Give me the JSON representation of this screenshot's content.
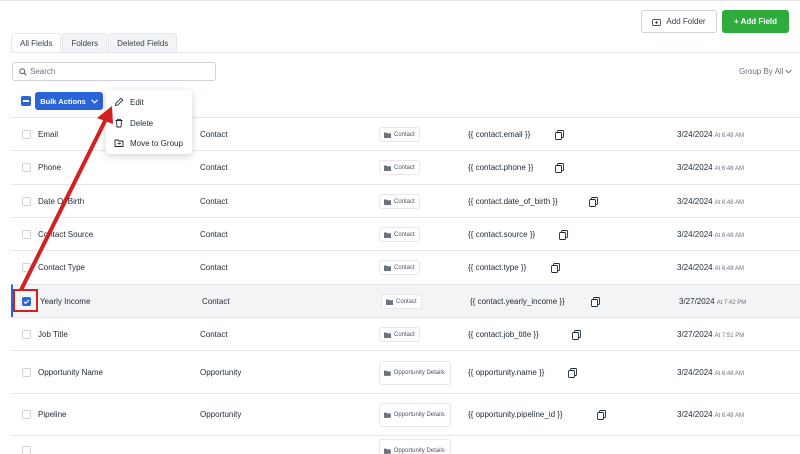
{
  "header": {
    "add_folder_label": "Add Folder",
    "add_field_label": "+ Add Field"
  },
  "tabs": [
    {
      "label": "All Fields",
      "active": true
    },
    {
      "label": "Folders",
      "active": false
    },
    {
      "label": "Deleted Fields",
      "active": false
    }
  ],
  "search": {
    "placeholder": "Search"
  },
  "group_by": {
    "label": "Group By All"
  },
  "bulk_actions": {
    "label": "Bulk Actions",
    "menu": [
      "Edit",
      "Delete",
      "Move to Group"
    ]
  },
  "rows": [
    {
      "name": "Email",
      "object": "Contact",
      "folder": "Contact",
      "key": "{{ contact.email }}",
      "date": "3/24/2024",
      "time": "At 6:48 AM",
      "checked": false
    },
    {
      "name": "Phone",
      "object": "Contact",
      "folder": "Contact",
      "key": "{{ contact.phone }}",
      "date": "3/24/2024",
      "time": "At 6:48 AM",
      "checked": false
    },
    {
      "name": "Date Of Birth",
      "object": "Contact",
      "folder": "Contact",
      "key": "{{ contact.date_of_birth }}",
      "date": "3/24/2024",
      "time": "At 6:48 AM",
      "checked": false
    },
    {
      "name": "Contact Source",
      "object": "Contact",
      "folder": "Contact",
      "key": "{{ contact.source }}",
      "date": "3/24/2024",
      "time": "At 6:48 AM",
      "checked": false
    },
    {
      "name": "Contact Type",
      "object": "Contact",
      "folder": "Contact",
      "key": "{{ contact.type }}",
      "date": "3/24/2024",
      "time": "At 6:48 AM",
      "checked": false
    },
    {
      "name": "Yearly Income",
      "object": "Contact",
      "folder": "Contact",
      "key": "{{ contact.yearly_income }}",
      "date": "3/27/2024",
      "time": "At 7:42 PM",
      "checked": true
    },
    {
      "name": "Job Title",
      "object": "Contact",
      "folder": "Contact",
      "key": "{{ contact.job_title }}",
      "date": "3/27/2024",
      "time": "At 7:51 PM",
      "checked": false
    },
    {
      "name": "Opportunity Name",
      "object": "Opportunity",
      "folder": "Opportunity Details",
      "key": "{{ opportunity.name }}",
      "date": "3/24/2024",
      "time": "At 6:48 AM",
      "checked": false
    },
    {
      "name": "Pipeline",
      "object": "Opportunity",
      "folder": "Opportunity Details",
      "key": "{{ opportunity.pipeline_id }}",
      "date": "3/24/2024",
      "time": "At 6:48 AM",
      "checked": false
    },
    {
      "name": "",
      "object": "",
      "folder": "Opportunity Details",
      "key": "",
      "date": "",
      "time": "",
      "checked": false
    }
  ],
  "colors": {
    "primary": "#2b63d9",
    "success": "#2eab3c",
    "annotation": "#d32020"
  }
}
